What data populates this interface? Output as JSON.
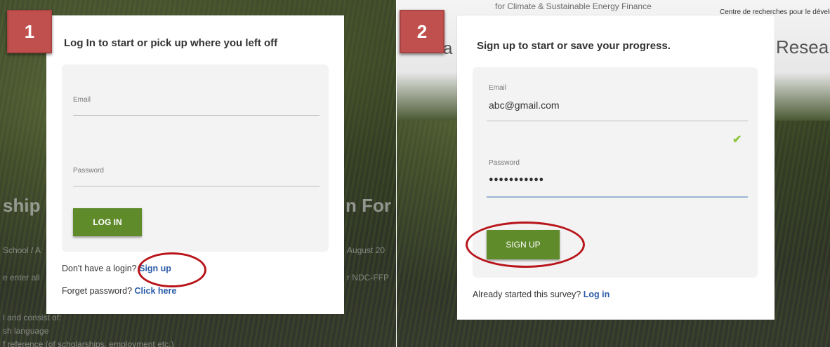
{
  "panel1": {
    "step": "1",
    "bg": {
      "heading_left": "ship",
      "heading_right": "n For",
      "line1_left": "School / A",
      "line1_right": "August 20",
      "line2_left": "e enter all",
      "line2_right": "r NDC-FFP",
      "line3": "l and consist of:",
      "line4": "sh language",
      "line5": "f reference (of scholarships, employment etc.)"
    },
    "modal": {
      "title": "Log In to start or pick up where you left off",
      "email_label": "Email",
      "email_value": "",
      "password_label": "Password",
      "password_value": "",
      "button_label": "LOG IN",
      "signup_prompt": "Don't have a login? ",
      "signup_link": "Sign up",
      "forgot_prompt": "Forget password? ",
      "forgot_link": "Click here"
    }
  },
  "panel2": {
    "step": "2",
    "bg": {
      "header_line1": "for Climate & Sustainable Energy Finance",
      "header_right": "Centre de recherches pour le dévelo",
      "left_fragment": "a",
      "right_fragment": "Resea"
    },
    "modal": {
      "title": "Sign up to start or save your progress.",
      "email_label": "Email",
      "email_value": "abc@gmail.com",
      "password_label": "Password",
      "password_value": "●●●●●●●●●●●",
      "button_label": "SIGN UP",
      "login_prompt": "Already started this survey? ",
      "login_link": "Log in"
    }
  },
  "colors": {
    "accent_green": "#5f8b2b",
    "link_blue": "#2a5aa8",
    "badge_red": "#c0504d",
    "highlight_oval": "#b8141a",
    "valid_check": "#8cc63f"
  },
  "icons": {
    "valid": "check-icon"
  }
}
